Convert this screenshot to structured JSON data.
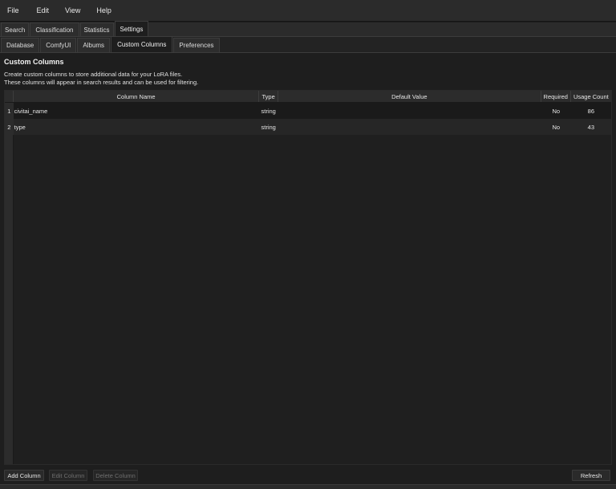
{
  "menu": [
    "File",
    "Edit",
    "View",
    "Help"
  ],
  "main_tabs": [
    "Search",
    "Classification",
    "Statistics",
    "Settings"
  ],
  "active_main_tab": "Settings",
  "sub_tabs": [
    "Database",
    "ComfyUI",
    "Albums",
    "Custom Columns",
    "Preferences"
  ],
  "active_sub_tab": "Custom Columns",
  "section": {
    "title": "Custom Columns",
    "desc_line1": "Create custom columns to store additional data for your LoRA files.",
    "desc_line2": "These columns will appear in search results and can be used for filtering."
  },
  "table": {
    "columns": [
      "Column Name",
      "Type",
      "Default Value",
      "Required",
      "Usage Count"
    ],
    "rows": [
      {
        "num": "1",
        "name": "civitai_name",
        "type": "string",
        "default": "",
        "required": "No",
        "usage": "86"
      },
      {
        "num": "2",
        "name": "type",
        "type": "string",
        "default": "",
        "required": "No",
        "usage": "43"
      }
    ]
  },
  "buttons": {
    "add": "Add Column",
    "edit": "Edit Column",
    "delete": "Delete Column",
    "refresh": "Refresh"
  }
}
